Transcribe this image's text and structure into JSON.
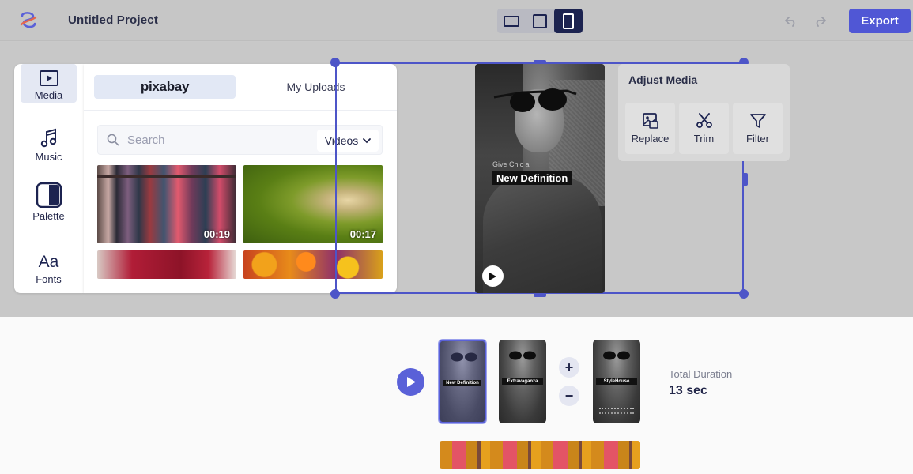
{
  "header": {
    "project_title": "Untitled Project",
    "export_label": "Export",
    "aspect_ratios": [
      "landscape",
      "square",
      "portrait"
    ],
    "active_ratio": "portrait"
  },
  "tools": {
    "items": [
      {
        "label": "Media",
        "icon": "media-play-icon"
      },
      {
        "label": "Music",
        "icon": "music-note-icon"
      },
      {
        "label": "Palette",
        "icon": "palette-icon"
      },
      {
        "label": "Fonts",
        "icon": "fonts-icon",
        "glyph": "Aa"
      }
    ],
    "active": "Media"
  },
  "media_panel": {
    "tabs": [
      "pixabay",
      "My Uploads"
    ],
    "active_tab": "pixabay",
    "search_placeholder": "Search",
    "type_selected": "Videos",
    "thumbnails": [
      {
        "duration": "00:19"
      },
      {
        "duration": "00:17"
      },
      {
        "duration": ""
      },
      {
        "duration": ""
      }
    ]
  },
  "preview": {
    "small_text": "Give Chic a",
    "headline": "New Definition"
  },
  "adjust_media": {
    "title": "Adjust Media",
    "buttons": [
      "Replace",
      "Trim",
      "Filter"
    ]
  },
  "timeline": {
    "slides": [
      {
        "caption": "New Definition",
        "selected": true
      },
      {
        "caption": "Extravaganza",
        "selected": false
      },
      {
        "caption": "StyleHouse",
        "selected": false
      }
    ],
    "add_symbol": "+",
    "remove_symbol": "−",
    "duration_label": "Total Duration",
    "duration_value": "13 sec"
  },
  "colors": {
    "accent": "#5057d5",
    "dark_active": "#1c2350",
    "selection": "#4d55c8"
  }
}
